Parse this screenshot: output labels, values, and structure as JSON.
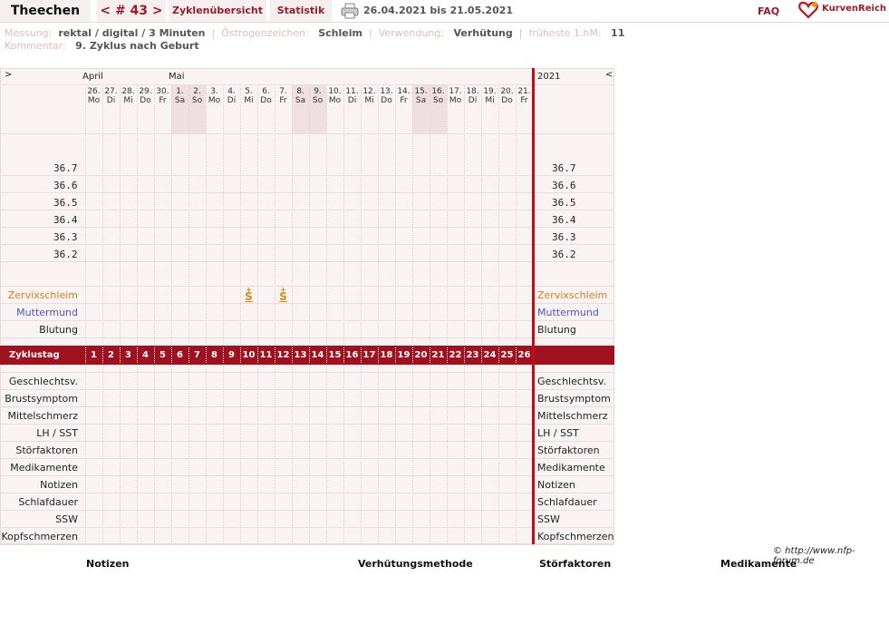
{
  "header": {
    "name": "Theechen",
    "cycle_nav": "< # 43 >",
    "tabs": [
      "Zyklenübersicht",
      "Statistik"
    ],
    "date_range": "26.04.2021 bis 21.05.2021",
    "faq": "FAQ",
    "logo": "KurvenReich",
    "print_icon": "printer-icon"
  },
  "info": {
    "messung_label": "Messung:",
    "messung_value": "rektal / digital / 3 Minuten",
    "oestrogen_label": "Östrogenzeichen:",
    "oestrogen_value": "Schleim",
    "verwendung_label": "Verwendung:",
    "verwendung_value": "Verhütung",
    "hm_label": "früheste 1.hM:",
    "hm_value": "11",
    "kommentar_label": "Kommentar:",
    "kommentar_value": "9. Zyklus nach Geburt"
  },
  "chart": {
    "nav_prev": ">",
    "nav_next": "<",
    "months": [
      {
        "label": "April",
        "col": 0
      },
      {
        "label": "Mai",
        "col": 5
      }
    ],
    "year": "2021",
    "days": [
      {
        "d": "26.",
        "w": "Mo",
        "we": false
      },
      {
        "d": "27.",
        "w": "Di",
        "we": false
      },
      {
        "d": "28.",
        "w": "Mi",
        "we": false
      },
      {
        "d": "29.",
        "w": "Do",
        "we": false
      },
      {
        "d": "30.",
        "w": "Fr",
        "we": false
      },
      {
        "d": "1.",
        "w": "Sa",
        "we": true
      },
      {
        "d": "2.",
        "w": "So",
        "we": true
      },
      {
        "d": "3.",
        "w": "Mo",
        "we": false
      },
      {
        "d": "4.",
        "w": "Di",
        "we": false
      },
      {
        "d": "5.",
        "w": "Mi",
        "we": false
      },
      {
        "d": "6.",
        "w": "Do",
        "we": false
      },
      {
        "d": "7.",
        "w": "Fr",
        "we": false
      },
      {
        "d": "8.",
        "w": "Sa",
        "we": true
      },
      {
        "d": "9.",
        "w": "So",
        "we": true
      },
      {
        "d": "10.",
        "w": "Mo",
        "we": false
      },
      {
        "d": "11.",
        "w": "Di",
        "we": false
      },
      {
        "d": "12.",
        "w": "Mi",
        "we": false
      },
      {
        "d": "13.",
        "w": "Do",
        "we": false
      },
      {
        "d": "14.",
        "w": "Fr",
        "we": false
      },
      {
        "d": "15.",
        "w": "Sa",
        "we": true
      },
      {
        "d": "16.",
        "w": "So",
        "we": true
      },
      {
        "d": "17.",
        "w": "Mo",
        "we": false
      },
      {
        "d": "18.",
        "w": "Di",
        "we": false
      },
      {
        "d": "19.",
        "w": "Mi",
        "we": false
      },
      {
        "d": "20.",
        "w": "Do",
        "we": false
      },
      {
        "d": "21.",
        "w": "Fr",
        "we": false
      }
    ],
    "temperatures": [
      "36.7",
      "36.6",
      "36.5",
      "36.4",
      "36.3",
      "36.2"
    ],
    "top_rows": [
      {
        "label": "Zervixschleim",
        "color": "#e07c14"
      },
      {
        "label": "Muttermund",
        "color": "#4a55c0"
      },
      {
        "label": "Blutung",
        "color": "#222222"
      }
    ],
    "cervix_marks": [
      {
        "day": 10,
        "symbol": "S"
      },
      {
        "day": 12,
        "symbol": "S"
      }
    ],
    "cycle_label": "Zyklustag",
    "cycle_days": [
      "1",
      "2",
      "3",
      "4",
      "5",
      "6",
      "7",
      "8",
      "9",
      "10",
      "11",
      "12",
      "13",
      "14",
      "15",
      "16",
      "17",
      "18",
      "19",
      "20",
      "21",
      "22",
      "23",
      "24",
      "25",
      "26"
    ],
    "bottom_rows": [
      "Geschlechtsv.",
      "Brustsymptom",
      "Mittelschmerz",
      "LH / SST",
      "Störfaktoren",
      "Medikamente",
      "Notizen",
      "Schlafdauer",
      "SSW",
      "Kopfschmerzen"
    ],
    "accent": "#a0101e",
    "weekend_fill": "#efdfe0"
  },
  "footer": {
    "credit": "© http://www.nfp-forum.de",
    "titles": [
      "Notizen",
      "Verhütungsmethode",
      "Störfaktoren",
      "Medikamente"
    ]
  }
}
